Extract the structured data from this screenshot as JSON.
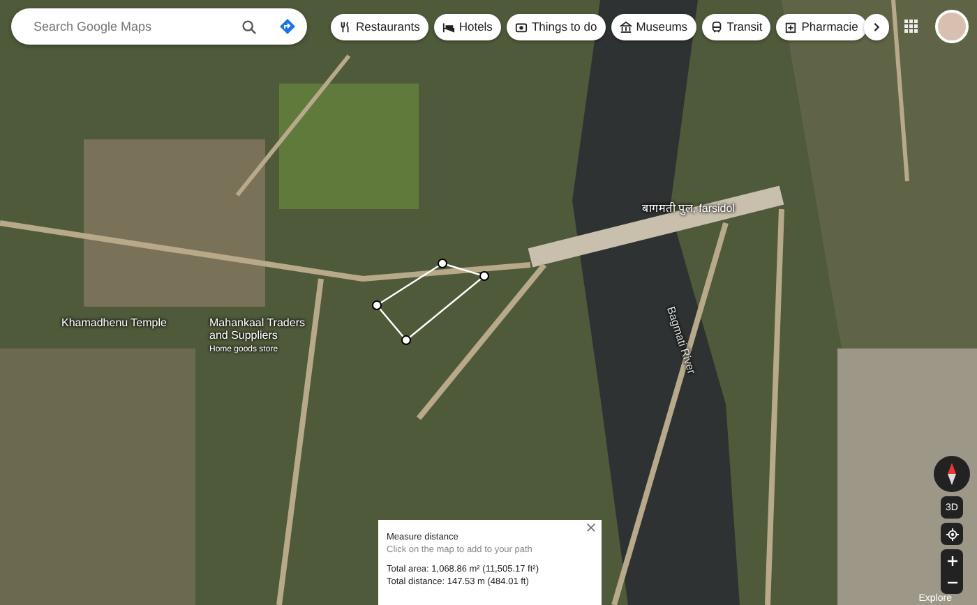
{
  "search": {
    "placeholder": "Search Google Maps"
  },
  "chips": [
    {
      "label": "Restaurants",
      "kind": "fork"
    },
    {
      "label": "Hotels",
      "kind": "bed"
    },
    {
      "label": "Things to do",
      "kind": "camera"
    },
    {
      "label": "Museums",
      "kind": "museum"
    },
    {
      "label": "Transit",
      "kind": "train"
    },
    {
      "label": "Pharmacie",
      "kind": "pharmacy"
    }
  ],
  "map_labels": [
    {
      "text": "Khamadhenu Temple",
      "kind": "place"
    },
    {
      "text": "Mahankaal Traders and Suppliers",
      "kind": "place"
    },
    {
      "text": "Home goods store",
      "kind": "sub"
    },
    {
      "text": "बागमती पुल, farsidol",
      "kind": "place"
    },
    {
      "text": "Bagmati River",
      "kind": "river"
    }
  ],
  "measure": {
    "title": "Measure distance",
    "hint": "Click on the map to add to your path",
    "area": "Total area: 1,068.86 m² (11,505.17 ft²)",
    "distance": "Total distance: 147.53 m (484.01 ft)"
  },
  "controls": {
    "three_d": "3D",
    "explore": "Explore"
  }
}
